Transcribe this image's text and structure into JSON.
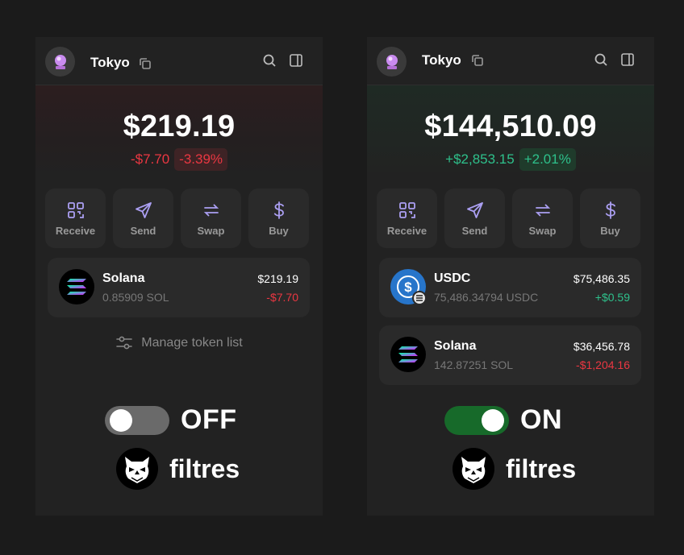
{
  "left": {
    "account_name": "Tokyo",
    "balance": "$219.19",
    "change_amount": "-$7.70",
    "change_percent": "-3.39%",
    "actions": [
      {
        "label": "Receive",
        "icon": "qr-icon"
      },
      {
        "label": "Send",
        "icon": "send-icon"
      },
      {
        "label": "Swap",
        "icon": "swap-icon"
      },
      {
        "label": "Buy",
        "icon": "dollar-icon"
      }
    ],
    "tokens": [
      {
        "name": "Solana",
        "amount": "0.85909 SOL",
        "value": "$219.19",
        "change": "-$7.70"
      }
    ],
    "manage_label": "Manage token list",
    "toggle_label": "OFF",
    "brand": "filtres"
  },
  "right": {
    "account_name": "Tokyo",
    "balance": "$144,510.09",
    "change_amount": "+$2,853.15",
    "change_percent": "+2.01%",
    "actions": [
      {
        "label": "Receive",
        "icon": "qr-icon"
      },
      {
        "label": "Send",
        "icon": "send-icon"
      },
      {
        "label": "Swap",
        "icon": "swap-icon"
      },
      {
        "label": "Buy",
        "icon": "dollar-icon"
      }
    ],
    "tokens": [
      {
        "name": "USDC",
        "amount": "75,486.34794 USDC",
        "value": "$75,486.35",
        "change": "+$0.59"
      },
      {
        "name": "Solana",
        "amount": "142.87251 SOL",
        "value": "$36,456.78",
        "change": "-$1,204.16"
      }
    ],
    "toggle_label": "ON",
    "brand": "filtres"
  },
  "colors": {
    "negative": "#eb3742",
    "positive": "#2ec08b",
    "accent": "#ab9ff2",
    "toggle_on": "#176a2a",
    "toggle_off": "#6a6a6a"
  }
}
